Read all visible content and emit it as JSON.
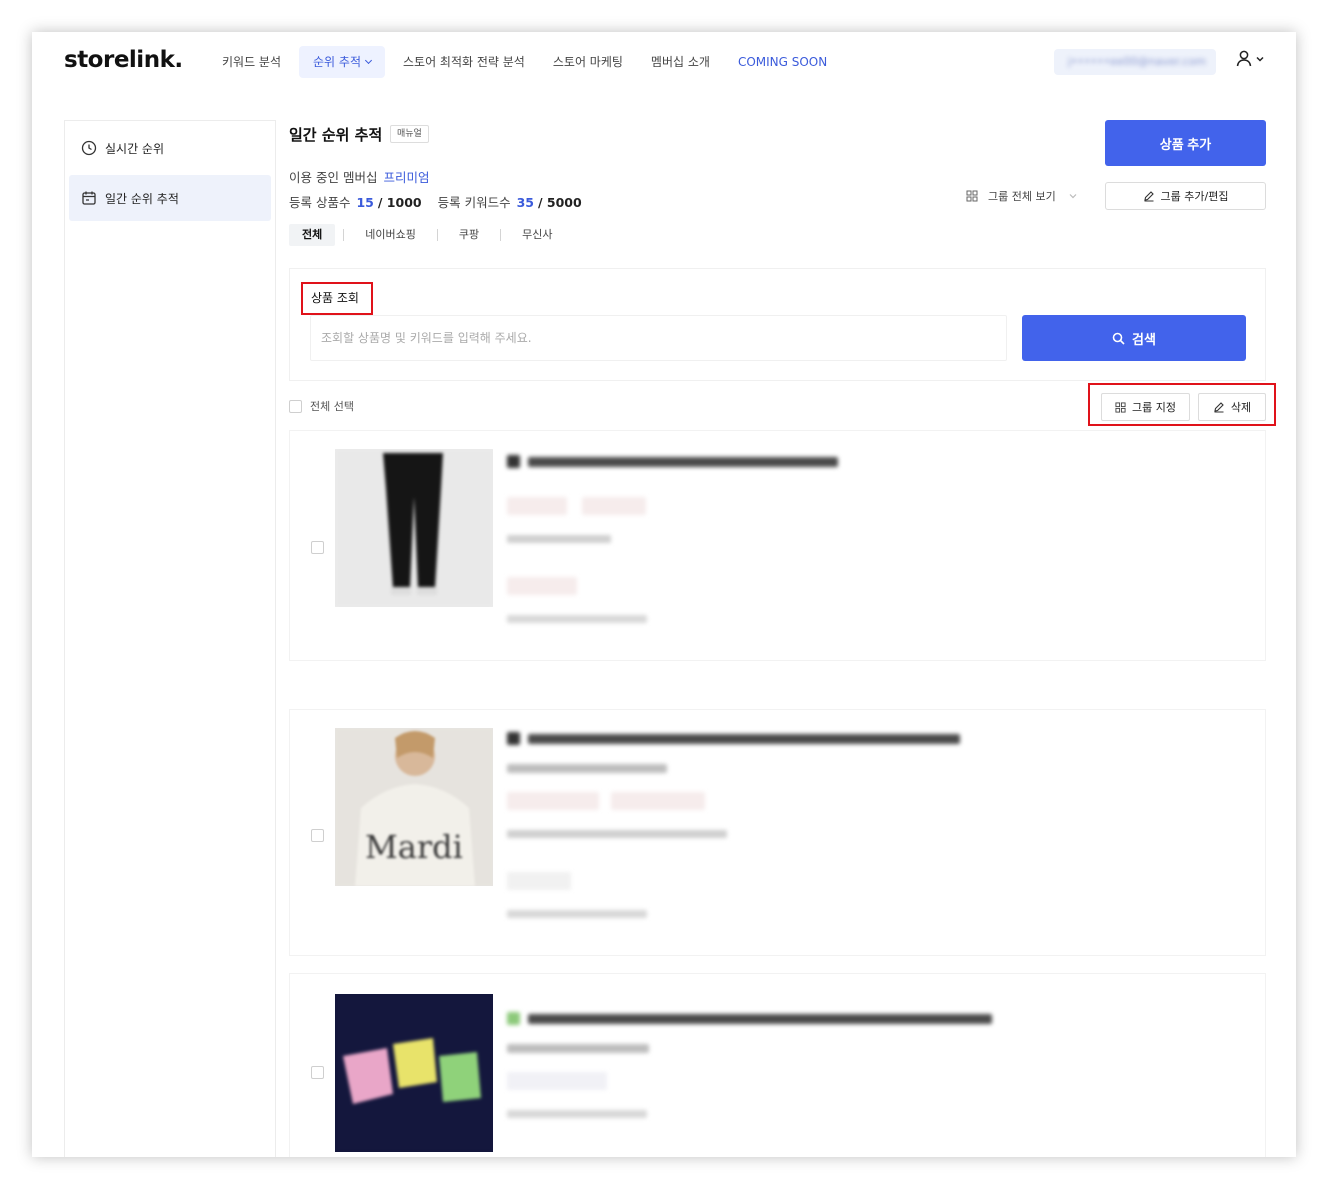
{
  "header": {
    "logo": "storelink.",
    "nav": [
      {
        "label": "키워드 분석",
        "active": false
      },
      {
        "label": "순위 추적",
        "active": true
      },
      {
        "label": "스토어 최적화 전략 분석",
        "active": false
      },
      {
        "label": "스토어 마케팅",
        "active": false
      },
      {
        "label": "멤버십 소개",
        "active": false
      },
      {
        "label": "COMING SOON",
        "active": false
      }
    ],
    "user_email": "j••••••ee00@naver.com"
  },
  "sidebar": {
    "items": [
      {
        "label": "실시간 순위",
        "icon": "clock-icon"
      },
      {
        "label": "일간 순위 추적",
        "icon": "calendar-icon"
      }
    ]
  },
  "main": {
    "title": "일간 순위 추적",
    "manual_badge": "매뉴얼",
    "membership_label": "이용 중인 멤버십",
    "membership_plan": "프리미엄",
    "products_label": "등록 상품수",
    "products_count": "15",
    "products_total": "/ 1000",
    "keywords_label": "등록 키워드수",
    "keywords_count": "35",
    "keywords_total": "/ 5000",
    "add_product_label": "상품 추가",
    "group_view_label": "그룹 전체 보기",
    "group_edit_label": "그룹 추가/편집",
    "tabs": [
      {
        "label": "전체",
        "active": true
      },
      {
        "label": "네이버쇼핑",
        "active": false
      },
      {
        "label": "쿠팡",
        "active": false
      },
      {
        "label": "무신사",
        "active": false
      }
    ],
    "search": {
      "label": "상품 조회",
      "placeholder": "조회할 상품명 및 키워드를 입력해 주세요.",
      "button": "검색"
    },
    "select_all_label": "전체 선택",
    "group_assign_label": "그룹 지정",
    "delete_label": "삭제"
  },
  "colors": {
    "accent": "#4263eb",
    "highlight_box": "#e0121a"
  }
}
